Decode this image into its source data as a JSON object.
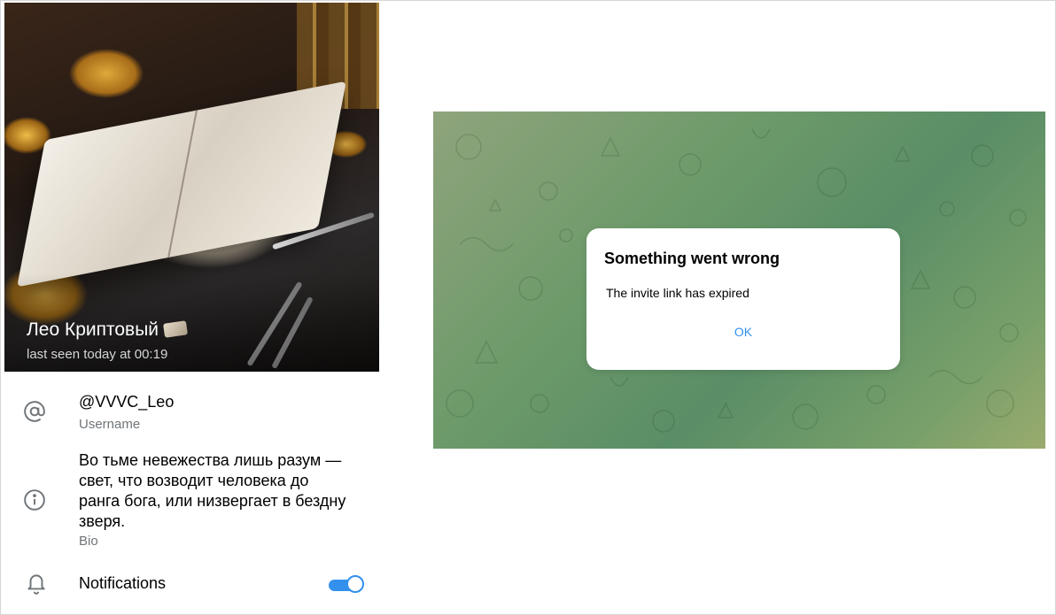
{
  "profile": {
    "name": "Лео Криптовый",
    "last_seen": "last seen today at 00:19",
    "username": "@VVVC_Leo",
    "username_label": "Username",
    "bio_lines": [
      "Во тьме невежества лишь разум —",
      "свет, что возводит человека до",
      "ранга бога, или низвергает в бездну",
      "зверя."
    ],
    "bio_label": "Bio",
    "notifications_label": "Notifications",
    "notifications_enabled": true
  },
  "dialog": {
    "title": "Something went wrong",
    "message": "The invite link has expired",
    "ok_label": "OK"
  },
  "colors": {
    "accent": "#3390ec",
    "secondary_text": "#707579",
    "chat_background": "#6d9a6a"
  },
  "icons": {
    "username": "at-sign-icon",
    "bio": "info-icon",
    "notifications": "bell-icon",
    "name_emoji": "newspaper-emoji-icon"
  }
}
